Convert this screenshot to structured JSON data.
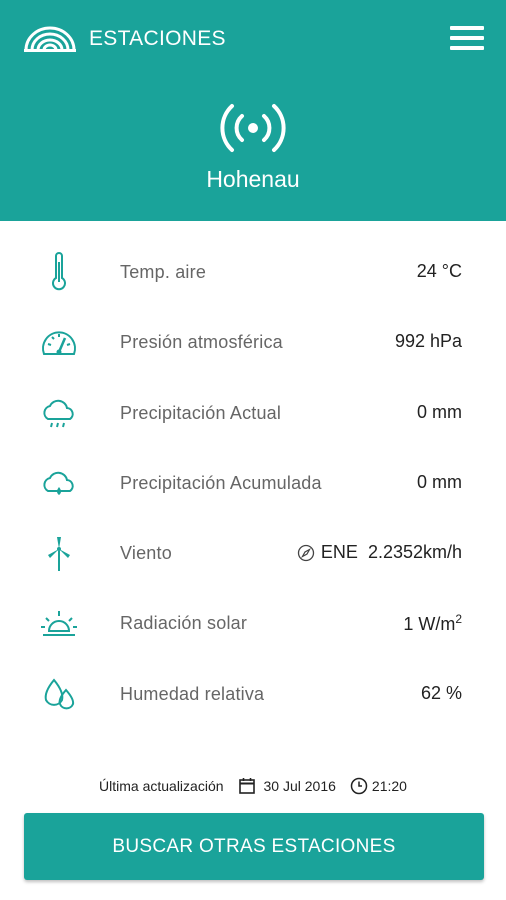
{
  "header": {
    "title": "ESTACIONES",
    "station": "Hohenau",
    "logo_icon": "rainbow-logo-icon",
    "menu_icon": "hamburger-menu-icon",
    "station_icon": "broadcast-signal-icon"
  },
  "rows": [
    {
      "icon": "thermometer-icon",
      "label": "Temp. aire",
      "value": "24 °C"
    },
    {
      "icon": "gauge-icon",
      "label": "Presión atmosférica",
      "value": "992 hPa"
    },
    {
      "icon": "rain-cloud-icon",
      "label": "Precipitación Actual",
      "value": "0 mm"
    },
    {
      "icon": "cloud-drop-icon",
      "label": "Precipitación Acumulada",
      "value": "0 mm"
    },
    {
      "icon": "wind-turbine-icon",
      "label": "Viento",
      "direction": "ENE",
      "value": "2.2352km/h"
    },
    {
      "icon": "sunrise-icon",
      "label": "Radiación solar",
      "value": "1 W/m",
      "sup": "2"
    },
    {
      "icon": "water-drops-icon",
      "label": "Humedad relativa",
      "value": "62 %"
    }
  ],
  "update": {
    "label": "Última actualización",
    "date": "30 Jul 2016",
    "time": "21:20"
  },
  "button": {
    "label": "BUSCAR OTRAS ESTACIONES"
  },
  "colors": {
    "accent": "#1aa39a",
    "icon": "#1aa39a"
  }
}
